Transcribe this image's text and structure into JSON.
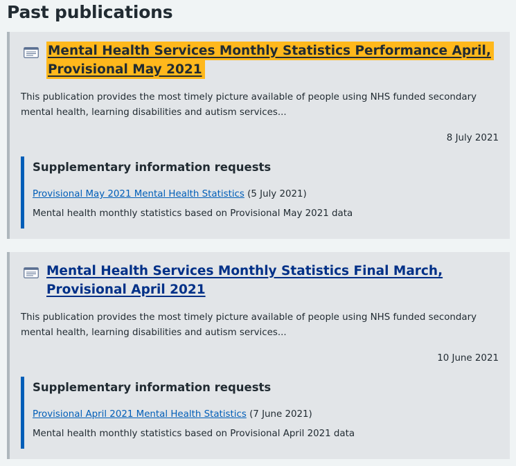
{
  "page_title": "Past publications",
  "publications": [
    {
      "title": "Mental Health Services Monthly Statistics Performance April, Provisional May 2021",
      "description": "This publication provides the most timely picture available of people using NHS funded secondary mental health, learning disabilities and autism services...",
      "date": "8 July 2021",
      "focused": true,
      "supplementary": {
        "heading": "Supplementary information requests",
        "link_text": "Provisional May 2021 Mental Health Statistics",
        "link_date": "(5 July 2021)",
        "description": "Mental health monthly statistics based on Provisional May 2021 data"
      }
    },
    {
      "title": "Mental Health Services Monthly Statistics Final March, Provisional April 2021",
      "description": "This publication provides the most timely picture available of people using NHS funded secondary mental health, learning disabilities and autism services...",
      "date": "10 June 2021",
      "focused": false,
      "supplementary": {
        "heading": "Supplementary information requests",
        "link_text": "Provisional April 2021 Mental Health Statistics",
        "link_date": "(7 June 2021)",
        "description": "Mental health monthly statistics based on Provisional April 2021 data"
      }
    }
  ],
  "colors": {
    "link": "#003087",
    "focus": "#ffb81c",
    "accent_border": "#005eb8",
    "card_background": "#e2e5e8"
  },
  "icons": {
    "publication": "document-icon"
  }
}
